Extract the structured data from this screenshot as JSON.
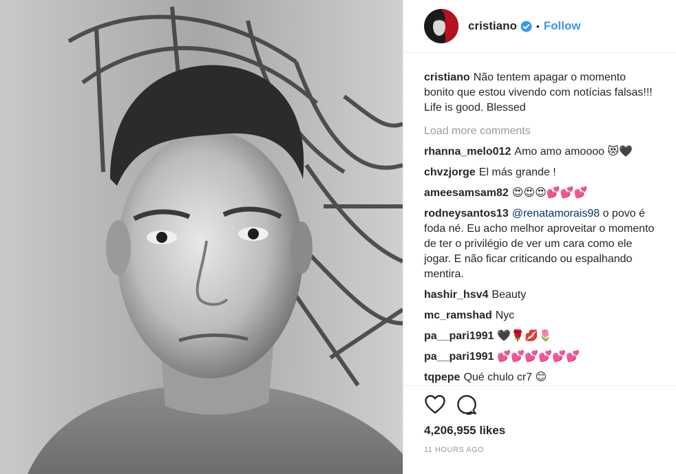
{
  "header": {
    "username": "cristiano",
    "separator": "•",
    "follow_label": "Follow"
  },
  "caption": {
    "username": "cristiano",
    "text": "Não tentem apagar o momento bonito que estou vivendo com notícias falsas!!! Life is good. Blessed"
  },
  "load_more_label": "Load more comments",
  "comments": [
    {
      "username": "rhanna_melo012",
      "text": "Amo amo amoooo 😻🖤"
    },
    {
      "username": "chvzjorge",
      "text": "El más grande !"
    },
    {
      "username": "ameesamsam82",
      "text": "😍😍😍💕💕💕"
    },
    {
      "username": "rodneysantos13",
      "mention": "@renatamorais98",
      "text": " o povo é foda né. Eu acho melhor aproveitar o momento de ter o privilégio de ver um cara como ele jogar. E não ficar criticando ou espalhando mentira."
    },
    {
      "username": "hashir_hsv4",
      "text": "Beauty"
    },
    {
      "username": "mc_ramshad",
      "text": "Nyc"
    },
    {
      "username": "pa__pari1991",
      "text": "🖤🌹💋🌷"
    },
    {
      "username": "pa__pari1991",
      "text": "💕💕💕💕💕💕"
    },
    {
      "username": "tqpepe",
      "text": "Qué chulo cr7 😊"
    }
  ],
  "likes_text": "4,206,955 likes",
  "timestamp": "11 HOURS AGO",
  "icons": {
    "like": "heart-icon",
    "comment": "comment-icon",
    "verified": "verified-badge-icon"
  },
  "colors": {
    "link": "#3897f0",
    "text": "#262626",
    "muted": "#999999",
    "mention": "#003569"
  }
}
